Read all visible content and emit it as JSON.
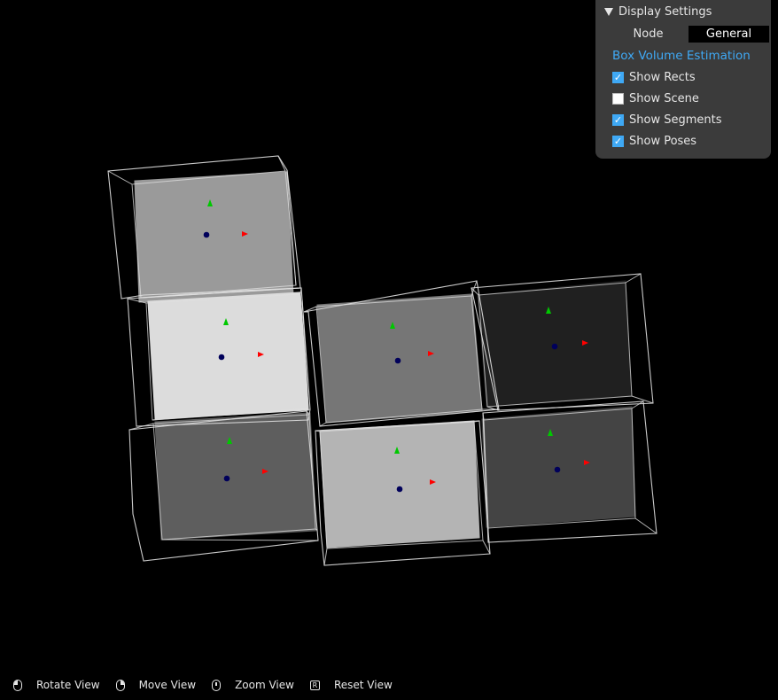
{
  "settings": {
    "title": "Display Settings",
    "tabs": [
      {
        "label": "Node",
        "active": false
      },
      {
        "label": "General",
        "active": true
      }
    ],
    "section": "Box Volume Estimation",
    "options": [
      {
        "label": "Show Rects",
        "checked": true
      },
      {
        "label": "Show Scene",
        "checked": false
      },
      {
        "label": "Show Segments",
        "checked": true
      },
      {
        "label": "Show Poses",
        "checked": true
      }
    ]
  },
  "hints": [
    {
      "icon": "left-mouse-icon",
      "label": "Rotate View"
    },
    {
      "icon": "right-mouse-icon",
      "label": "Move View"
    },
    {
      "icon": "scroll-wheel-icon",
      "label": "Zoom View"
    },
    {
      "icon": "r-key-icon",
      "key": "R",
      "label": "Reset View"
    }
  ],
  "colors": {
    "accent": "#3fa9f5",
    "pose_x": "#ff0000",
    "pose_y": "#00c800",
    "pose_origin": "#00005a",
    "rect_outline": "#e0e0e0"
  },
  "boxes": [
    {
      "name": "box-top-left",
      "shade": "#9a9a9a"
    },
    {
      "name": "box-middle-left",
      "shade": "#dcdcdc"
    },
    {
      "name": "box-bottom-left",
      "shade": "#5e5e5e"
    },
    {
      "name": "box-middle-center",
      "shade": "#767676"
    },
    {
      "name": "box-bottom-center",
      "shade": "#b4b4b4"
    },
    {
      "name": "box-middle-right",
      "shade": "#202020"
    },
    {
      "name": "box-bottom-right",
      "shade": "#444444"
    }
  ]
}
